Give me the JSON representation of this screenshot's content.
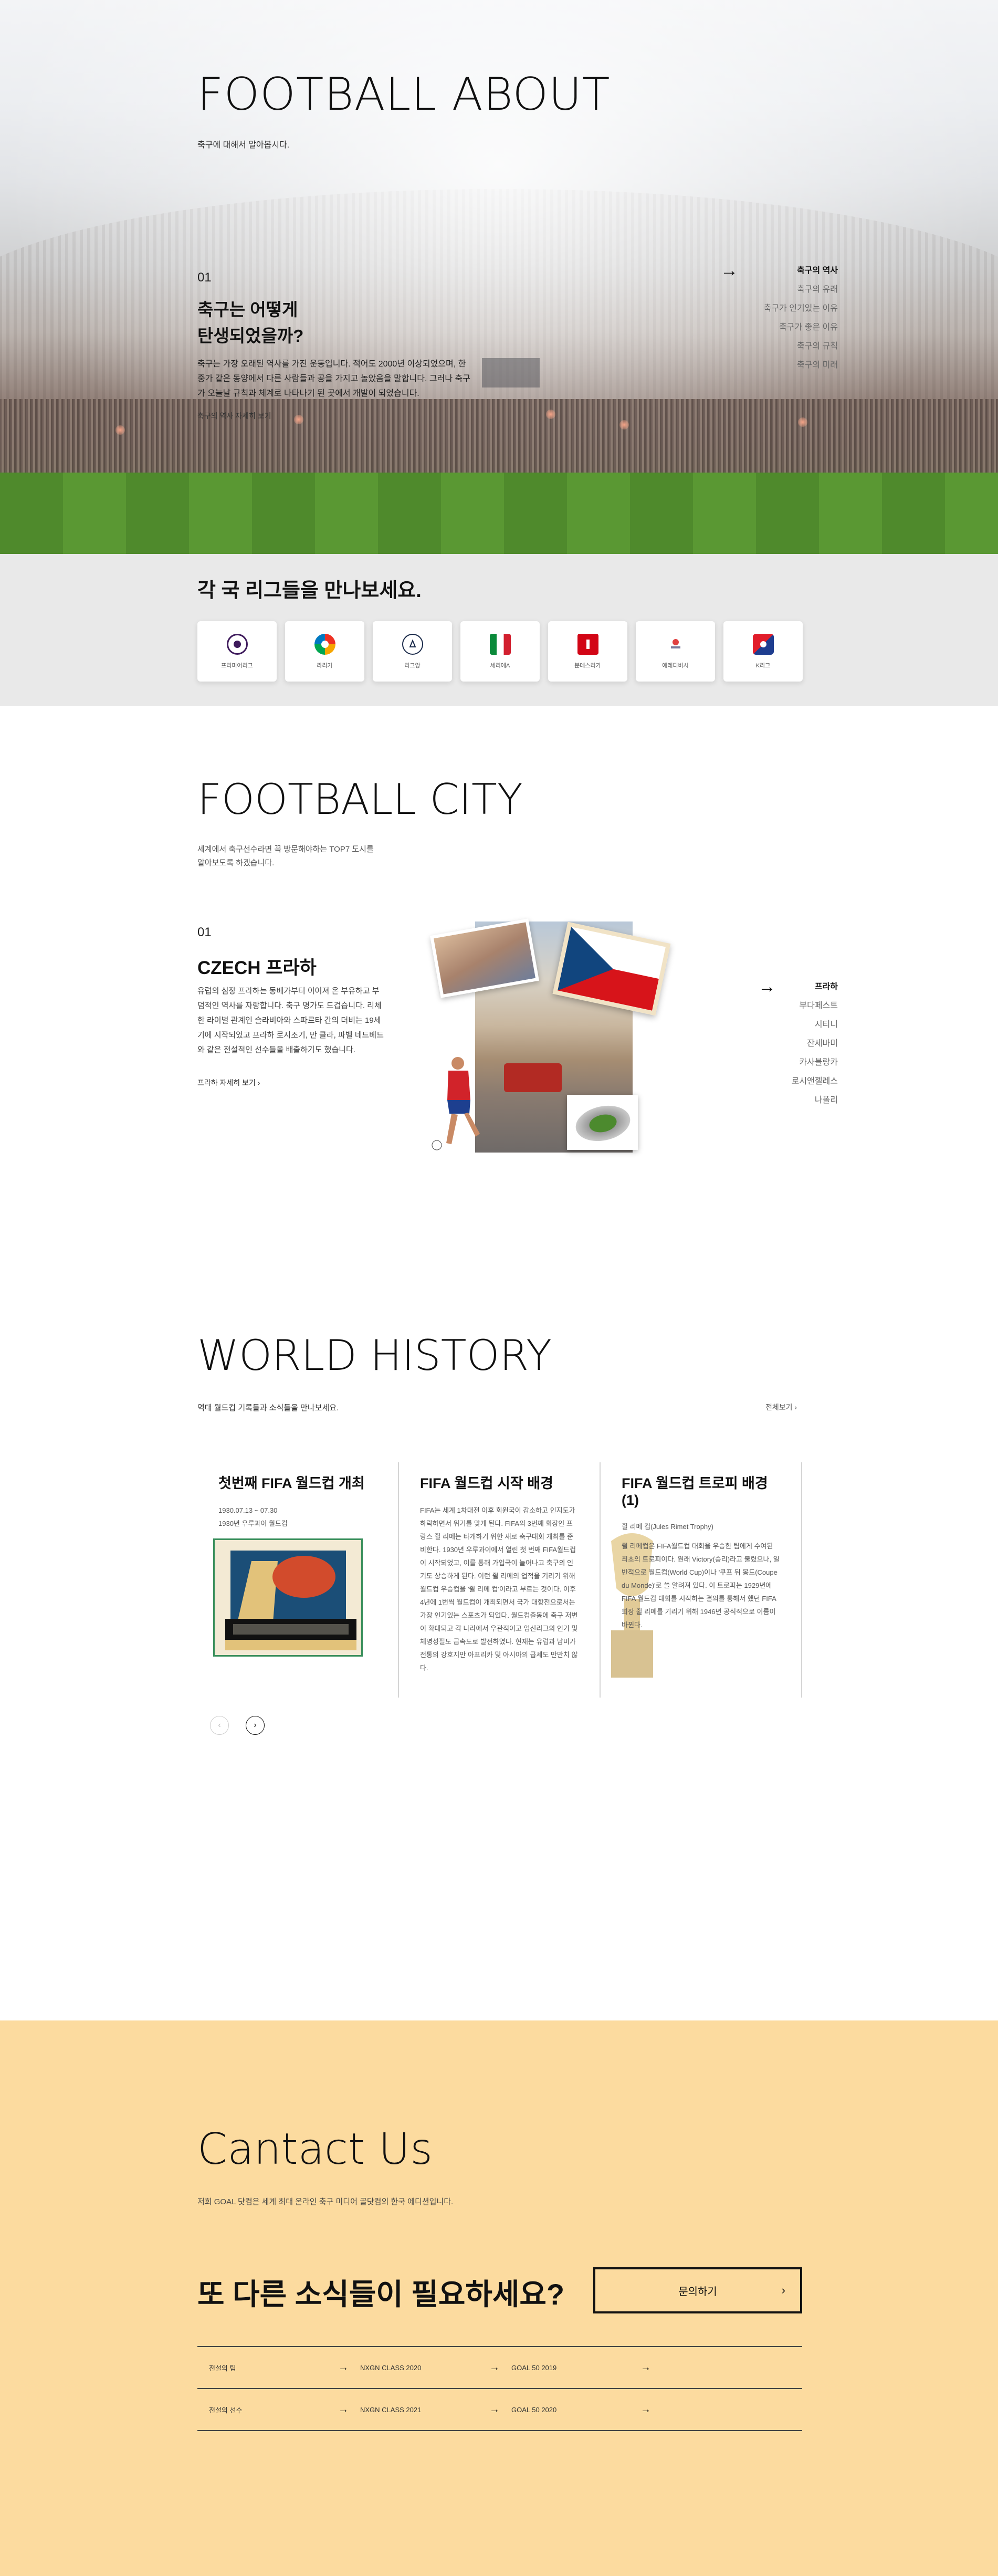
{
  "hero": {
    "title": "FOOTBALL ABOUT",
    "subtitle": "축구에 대해서 알아봅시다.",
    "number": "01",
    "question_line1": "축구는 어떻게",
    "question_line2": "탄생되었을까?",
    "description": "축구는 가장 오래된 역사를 가진 운동입니다. 적어도 2000년 이상되었으며, 한중가 같은 동양에서 다른 사람들과 공을 가지고 놀았음을 말합니다. 그러나 축구가 오늘날 규칙과 체계로 나타나기 된 곳에서 개발이 되었습니다.",
    "more_link": "축구의 역사 자세히 보기",
    "side_nav": [
      "축구의 역사",
      "축구의 유래",
      "축구가 인기있는 이유",
      "축구가 좋은 이유",
      "축구의 규칙",
      "축구의 미래"
    ],
    "side_nav_active": 0
  },
  "leagues": {
    "heading": "각 국 리그들을 만나보세요.",
    "items": [
      {
        "name": "프리미어리그",
        "color": "#3d195b",
        "mark": "PL"
      },
      {
        "name": "라리가",
        "color": "#ee8707",
        "mark": "LL"
      },
      {
        "name": "리그앙",
        "color": "#1a2a4a",
        "mark": "L1"
      },
      {
        "name": "세리에A",
        "color": "#0a8a3a",
        "mark": "SA"
      },
      {
        "name": "분데스리가",
        "color": "#d20515",
        "mark": "BL"
      },
      {
        "name": "에레디비시",
        "color": "#7a7a9a",
        "mark": "ED"
      },
      {
        "name": "K리그",
        "color": "#1e3d8f",
        "mark": "K"
      }
    ]
  },
  "city": {
    "title": "FOOTBALL CITY",
    "description": "세계에서 축구선수라면 꼭 방문해야하는 TOP7 도시를 알아보도록 하겠습니다.",
    "number": "01",
    "name": "CZECH 프라하",
    "text": "유럽의 심장 프라하는 동베가부터 이어져 온 부유하고 부덤적인 역사를 자랑합니다. 축구 명가도 드겁습니다. 리체한 라이벌 관계인 슬라비아와 스파르타 간의 더비는 19세기에 시작되었고 프라하 로시조기, 만 클라, 파벨 네드베드와 같은 전설적인 선수들을 배출하기도 했습니다.",
    "more_link": "프라하 자세히 보기",
    "side_nav": [
      "프라하",
      "부다페스트",
      "시티니",
      "잔세바미",
      "카사블랑카",
      "로시앤젤레스",
      "나폴리"
    ],
    "side_nav_active": 0
  },
  "history": {
    "title": "WORLD HISTORY",
    "subtitle": "역대 월드컵 기록들과 소식들을 만나보세요.",
    "all_link": "전체보기",
    "cards": [
      {
        "title": "첫번째 FIFA 월드컵 개최",
        "lines": [
          "1930.07.13 ~ 07.30",
          "1930년 우루과이 월드컵"
        ]
      },
      {
        "title": "FIFA 월드컵 시작 배경",
        "lines": [
          "FIFA는 세계 1차대전 이후 회원국이 감소하고 인지도가 하락하면서 위기를 맞게 된다. FIFA의 3번째 회장인 프랑스 쥘 리메는 타개하기 위한 새로 축구대회 개최를 준비한다. 1930년 우루과이에서 열린 첫 번째 FIFA월드컵이 시작되었고, 이를 통해 가입국이 늘어나고 축구의 인기도 상승하게 된다. 이런 쥘 리메의 업적을 기리기 위해 월드컵 우승컵을 '쥘 리메 컵'이라고 부르는 것이다. 이후 4년에 1번씩 월드컵이 개최되면서 국가 대항전으로서는 가장 인기있는 스포츠가 되었다. 월드컵출동에 축구 저변이 확대되고 각 나라에서 우관적이고 업신리그의 인기 및 체명성필도 급속도로 발전하였다. 현재는 유럽과 남미가 전통의 강호지만 아프리카 및 아시아의 급세도 만만치 않다."
        ]
      },
      {
        "title": "FIFA 월드컵 트로피 배경(1)",
        "lines": [
          "쥘 리메 컵(Jules Rimet Trophy)",
          "쥘 리메컵은 FIFA월드컵 대회을 우승한 팀에게 수여된 최초의 트로피이다. 원래 Victory(승리)라고 불렸으나, 일반적으로 월드컵(World Cup)이나 '쿠프 뒤 몽드(Coupe du Monde)'로 쓸 알려져 있다. 이 트로피는 1929년에 FIFA 월드컵 대회를 시작하는 결의를 통해서 했던 FIFA 회장 쥘 리메를 기리기 위해 1946년 공식적으로 이름이 바뀐다."
        ]
      }
    ],
    "prev": "‹",
    "next": "›"
  },
  "contact": {
    "title": "Cantact Us",
    "subtitle": "저희 GOAL 닷컴은 세계 최대 온라인 축구 미디어 골닷컴의 한국 에디션입니다.",
    "question": "또 다른 소식들이 필요하세요?",
    "button": "문의하기",
    "rows": [
      [
        "전설의 팀",
        "NXGN CLASS 2020",
        "GOAL 50 2019"
      ],
      [
        "전설의 선수",
        "NXGN CLASS 2021",
        "GOAL 50 2020"
      ]
    ]
  }
}
